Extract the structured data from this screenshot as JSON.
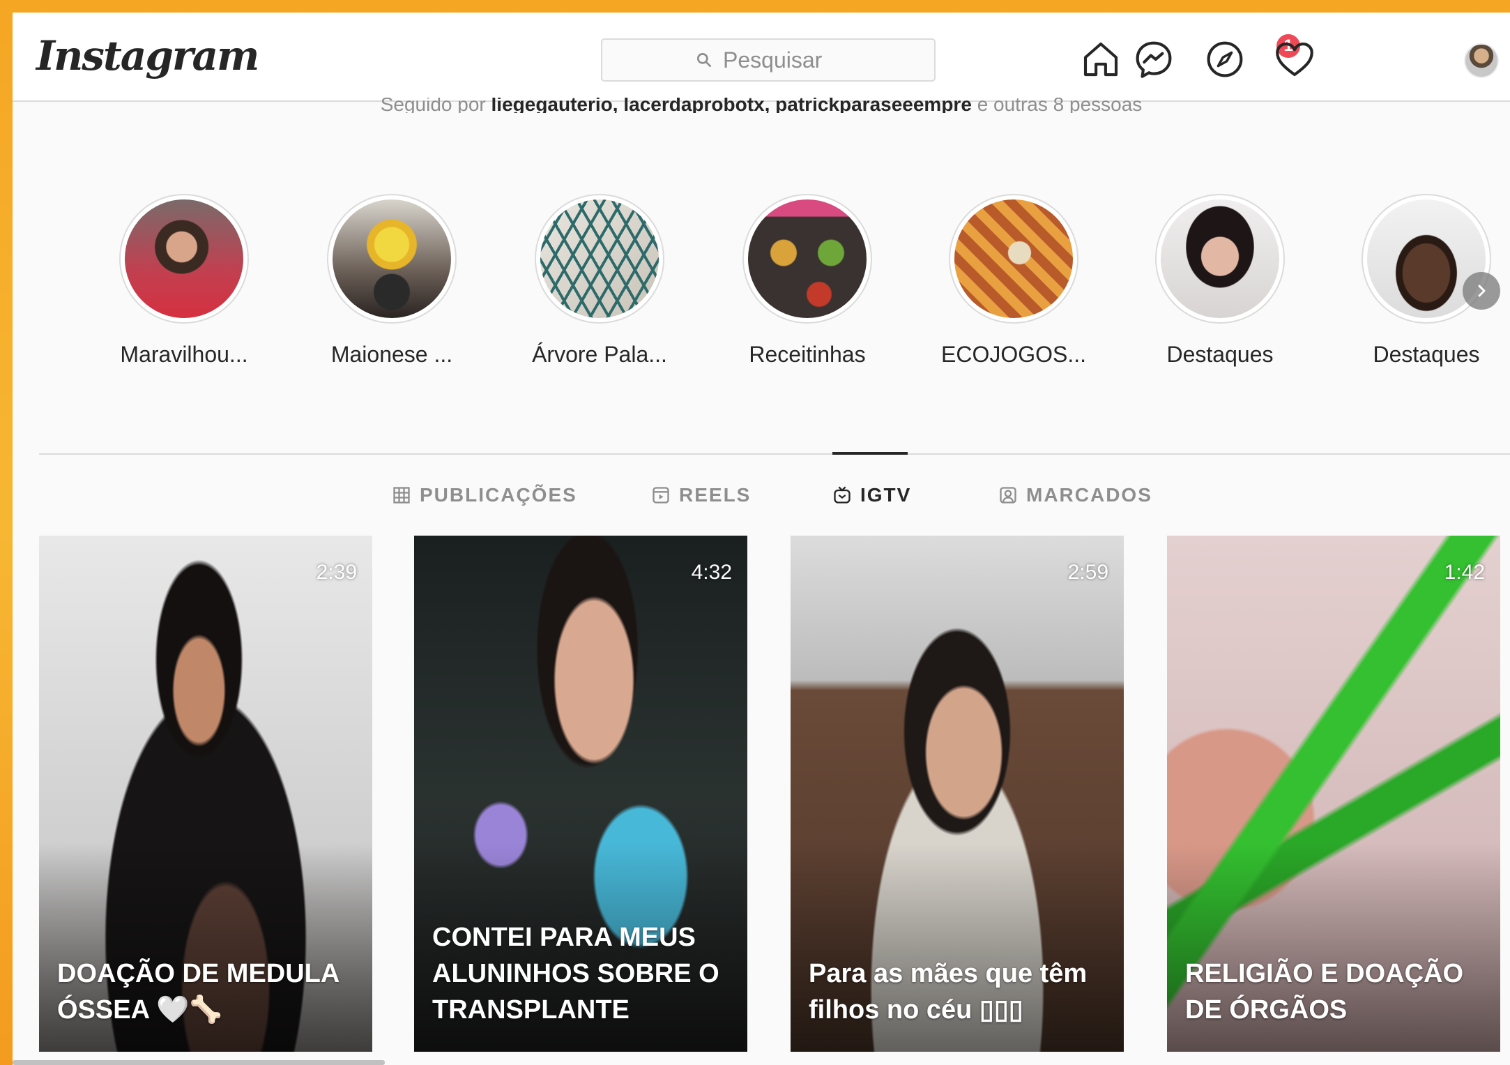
{
  "header": {
    "logo": "Instagram",
    "search_placeholder": "Pesquisar",
    "notification_count": "1"
  },
  "profile": {
    "followed_by_prefix": "Seguido por",
    "followed_by_users": "liegegauterio, lacerdaprobotx, patrickparaseeempre",
    "followed_by_suffix": "e outras 8 pessoas"
  },
  "highlights": [
    {
      "label": "Maravilhou..."
    },
    {
      "label": "Maionese ..."
    },
    {
      "label": "Árvore Pala..."
    },
    {
      "label": "Receitinhas"
    },
    {
      "label": "ECOJOGOS..."
    },
    {
      "label": "Destaques"
    },
    {
      "label": "Destaques"
    }
  ],
  "tabs": [
    {
      "label": "PUBLICAÇÕES",
      "active": false
    },
    {
      "label": "REELS",
      "active": false
    },
    {
      "label": "IGTV",
      "active": true
    },
    {
      "label": "MARCADOS",
      "active": false
    }
  ],
  "videos": [
    {
      "duration": "2:39",
      "title": "DOAÇÃO DE MEDULA ÓSSEA 🤍🦴"
    },
    {
      "duration": "4:32",
      "title": "CONTEI PARA MEUS ALUNINHOS SOBRE O TRANSPLANTE"
    },
    {
      "duration": "2:59",
      "title": "Para as mães que têm filhos no céu ▯▯▯"
    },
    {
      "duration": "1:42",
      "title": "RELIGIÃO E DOAÇÃO DE ÓRGÃOS"
    }
  ],
  "colors": {
    "frame_orange": "#f5a623",
    "badge_red": "#ed4956",
    "text_dark": "#262626",
    "text_muted": "#8e8e8e"
  }
}
